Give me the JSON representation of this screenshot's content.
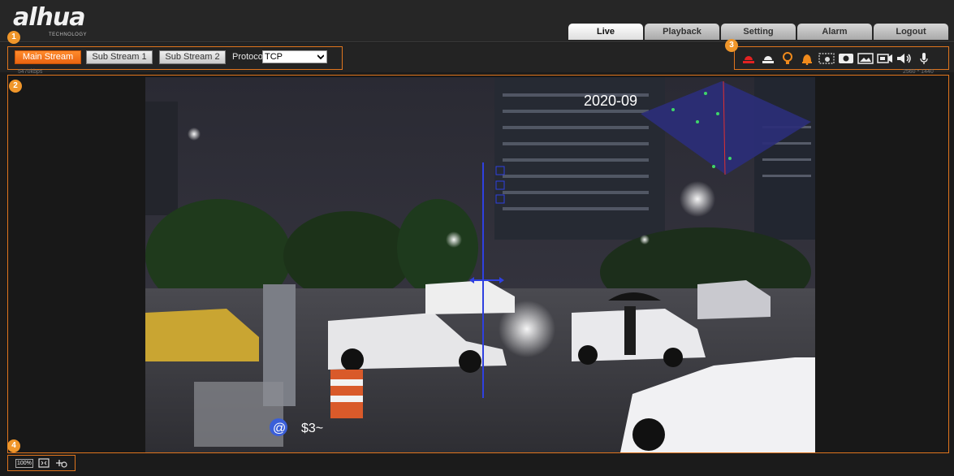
{
  "brand": {
    "logo": "alhua",
    "tagline": "TECHNOLOGY"
  },
  "nav": {
    "tabs": [
      "Live",
      "Playback",
      "Setting",
      "Alarm",
      "Logout"
    ],
    "active": 0
  },
  "stream": {
    "buttons": [
      "Main Stream",
      "Sub Stream 1",
      "Sub Stream 2"
    ],
    "active": 0,
    "protocol_label": "Protocol",
    "protocol_value": "TCP"
  },
  "toolbar_icons": [
    "alarm-light-red-icon",
    "alarm-light-white-icon",
    "warning-light-icon",
    "siren-bell-icon",
    "regional-focus-icon",
    "snapshot-icon",
    "image-mode-icon",
    "record-icon",
    "audio-icon",
    "microphone-icon"
  ],
  "status": {
    "bitrate": "5470kbps",
    "resolution": "2560 * 1440"
  },
  "overlay": {
    "date": "2020-09",
    "osd_text": "$3~"
  },
  "bottom": {
    "zoom": "100%"
  },
  "callouts": [
    "1",
    "2",
    "3",
    "4"
  ],
  "colors": {
    "accent": "#e0751e",
    "active_button": "#f27020",
    "radar": "#2b2e78"
  }
}
